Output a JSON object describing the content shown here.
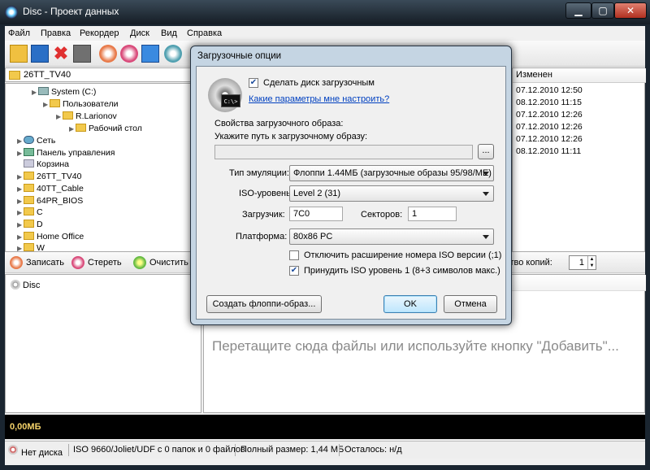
{
  "window": {
    "title": "Disc - Проект данных",
    "controls": {
      "minimize": "▁",
      "maximize": "▢",
      "close": "✕"
    }
  },
  "menu": [
    "Файл",
    "Правка",
    "Рекордер",
    "Диск",
    "Вид",
    "Справка"
  ],
  "toolbar": {
    "icons": [
      "new-icon",
      "save-icon",
      "delete-icon",
      "print-icon",
      "burn-icon",
      "erase-icon",
      "blank-icon",
      "disc-icon"
    ],
    "colors": {
      "new": "#f0c040",
      "save": "#2a6fc6",
      "delete": "#e03030",
      "print": "#707070",
      "burn": "#e87a4a",
      "erase": "#d94a7a",
      "blank": "#3a8ae0",
      "disc": "#50a0b0"
    }
  },
  "path": "26TT_TV40",
  "tree": [
    {
      "label": "System (C:)",
      "level": 3,
      "icon": "pc"
    },
    {
      "label": "Пользователи",
      "level": 4,
      "icon": "folder"
    },
    {
      "label": "R.Larionov",
      "level": 5,
      "icon": "folder"
    },
    {
      "label": "Рабочий стол",
      "level": 6,
      "icon": "folder"
    },
    {
      "label": "Сеть",
      "level": 1,
      "icon": "net"
    },
    {
      "label": "Панель управления",
      "level": 1,
      "icon": "ctl"
    },
    {
      "label": "Корзина",
      "level": 1,
      "icon": "trash"
    },
    {
      "label": "26TT_TV40",
      "level": 1,
      "icon": "folder"
    },
    {
      "label": "40TT_Cable",
      "level": 1,
      "icon": "folder"
    },
    {
      "label": "64PR_BIOS",
      "level": 1,
      "icon": "folder"
    },
    {
      "label": "C",
      "level": 1,
      "icon": "folder"
    },
    {
      "label": "D",
      "level": 1,
      "icon": "folder"
    },
    {
      "label": "Home Office",
      "level": 1,
      "icon": "folder"
    },
    {
      "label": "W",
      "level": 1,
      "icon": "folder"
    }
  ],
  "files": {
    "column": "Изменен",
    "dates": [
      "07.12.2010 12:50",
      "08.12.2010 11:15",
      "07.12.2010 12:26",
      "07.12.2010 12:26",
      "07.12.2010 12:26",
      "08.12.2010 11:11"
    ]
  },
  "actions": {
    "burn": "Записать",
    "erase": "Стереть",
    "clear": "Очистить",
    "copies_label": "ство копий:",
    "copies_value": "1"
  },
  "disc_tree": {
    "root": "Disc"
  },
  "dropzone": {
    "hint": "Перетащите сюда файлы или используйте кнопку \"Добавить\"..."
  },
  "size": {
    "value": "0,00МБ"
  },
  "status": {
    "no_disc": "Нет диска",
    "fs": "ISO 9660/Joliet/UDF с 0 папок и 0 файлов",
    "total": "Полный размер: 1,44 МБ",
    "left": "Осталось: н/д"
  },
  "dialog": {
    "title": "Загрузочные опции",
    "make_bootable": "Сделать диск загрузочным",
    "make_bootable_checked": true,
    "help_link": "Какие параметры мне настроить?",
    "group": "Свойства загрузочного образа:",
    "path_label": "Укажите путь к загрузочному образу:",
    "path_value": "",
    "browse": "...",
    "emulation_label": "Тип эмуляции:",
    "emulation_value": "Флоппи 1.44МБ (загрузочные образы 95/98/ME)",
    "iso_label": "ISO-уровень:",
    "iso_value": "Level 2 (31)",
    "loader_label": "Загрузчик:",
    "loader_value": "7C0",
    "sectors_label": "Секторов:",
    "sectors_value": "1",
    "platform_label": "Платформа:",
    "platform_value": "80x86 PC",
    "opt_disable_ext": "Отключить расширение номера ISO версии (;1)",
    "opt_disable_ext_checked": false,
    "opt_force_iso": "Принудить ISO уровень 1 (8+3 символов макс.)",
    "opt_force_iso_checked": true,
    "create_floppy": "Создать флоппи-образ...",
    "ok": "OK",
    "cancel": "Отмена",
    "console_glyph": "C:\\>"
  }
}
